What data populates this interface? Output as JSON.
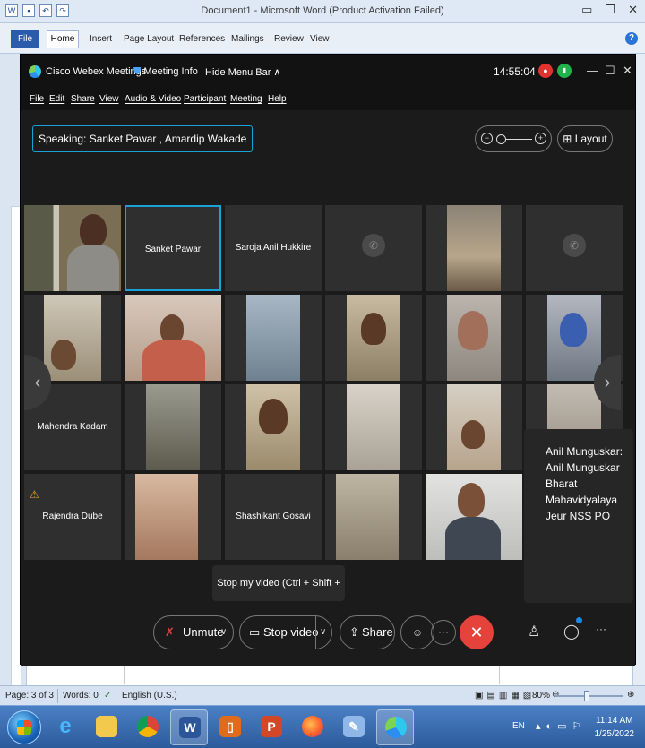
{
  "word": {
    "window_title": "Document1 - Microsoft Word (Product Activation Failed)",
    "tabs": [
      "File",
      "Home",
      "Insert",
      "Page Layout",
      "References",
      "Mailings",
      "Review",
      "View"
    ],
    "status": {
      "page": "Page: 3 of 3",
      "words": "Words: 0",
      "language": "English (U.S.)",
      "zoom": "80%"
    }
  },
  "taskbar": {
    "lang": "EN",
    "time": "11:14 AM",
    "date": "1/25/2022"
  },
  "webex": {
    "app_name": "Cisco Webex Meetings",
    "meeting_info": "Meeting Info",
    "hide_menu": "Hide Menu Bar ∧",
    "clock": "14:55:04",
    "menu": [
      "File",
      "Edit",
      "Share",
      "View",
      "Audio & Video",
      "Participant",
      "Meeting",
      "Help"
    ],
    "speaking": "Speaking: Sanket Pawar , Amardip Wakade",
    "layout_label": "Layout",
    "tiles": {
      "t2": "Sanket Pawar",
      "t3": "Saroja Anil Hukkire",
      "t13": "Mahendra Kadam",
      "t19": "Rajendra Dube",
      "t21": "Shashikant Gosavi"
    },
    "chat_tooltip": "Anil Munguskar: Anil Munguskar Bharat Mahavidyalaya Jeur NSS PO",
    "video_tooltip": "Stop my video (Ctrl + Shift + V)",
    "controls": {
      "unmute": "Unmute",
      "stop_video": "Stop video",
      "share": "Share"
    }
  }
}
